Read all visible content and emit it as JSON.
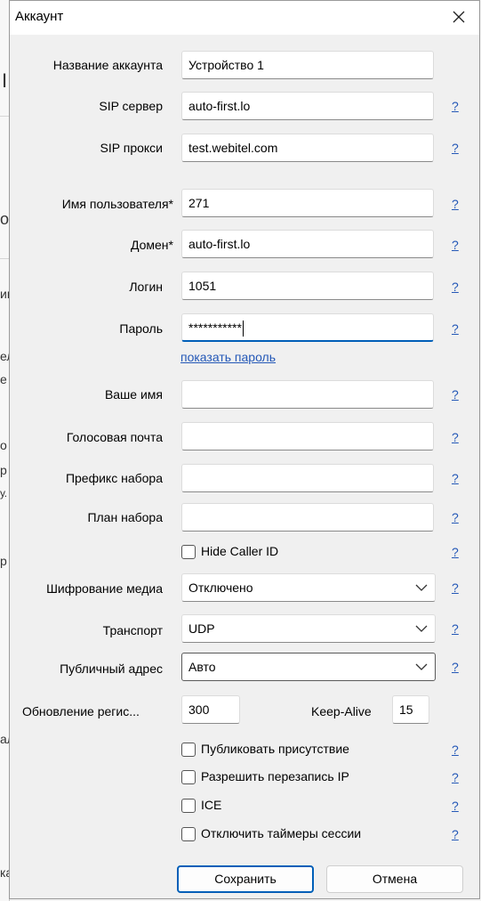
{
  "dialog": {
    "title": "Аккаунт",
    "help": "?",
    "fields": {
      "account_name": {
        "label": "Название аккаунта",
        "value": "Устройство 1"
      },
      "sip_server": {
        "label": "SIP сервер",
        "value": "auto-first.lo"
      },
      "sip_proxy": {
        "label": "SIP прокси",
        "value": "test.webitel.com"
      },
      "username": {
        "label": "Имя пользователя",
        "value": "271"
      },
      "domain": {
        "label": "Домен",
        "value": "auto-first.lo"
      },
      "login": {
        "label": "Логин",
        "value": "1051"
      },
      "password": {
        "label": "Пароль",
        "value": "***********"
      },
      "display_name": {
        "label": "Ваше имя",
        "value": ""
      },
      "voicemail": {
        "label": "Голосовая почта",
        "value": ""
      },
      "dial_prefix": {
        "label": "Префикс набора",
        "value": ""
      },
      "dial_plan": {
        "label": "План набора",
        "value": ""
      }
    },
    "required_mark": "*",
    "show_password_link": "показать пароль",
    "hide_caller_id": {
      "label": "Hide Caller ID",
      "checked": false
    },
    "media_encryption": {
      "label": "Шифрование медиа",
      "value": "Отключено"
    },
    "transport": {
      "label": "Транспорт",
      "value": "UDP"
    },
    "public_address": {
      "label": "Публичный адрес",
      "value": "Авто"
    },
    "registration_refresh": {
      "label": "Обновление регис...",
      "value": "300"
    },
    "keep_alive": {
      "label": "Keep-Alive",
      "value": "15"
    },
    "checkboxes": {
      "publish_presence": {
        "label": "Публиковать присутствие",
        "checked": false
      },
      "allow_ip_rewrite": {
        "label": "Разрешить перезапись IP",
        "checked": false
      },
      "ice": {
        "label": "ICE",
        "checked": false
      },
      "disable_session_timers": {
        "label": "Отключить таймеры сессии",
        "checked": false
      }
    },
    "buttons": {
      "save": "Сохранить",
      "cancel": "Отмена"
    }
  },
  "background": {
    "fragments": [
      "I",
      "о",
      "ии",
      "ел",
      "е",
      "о",
      "р",
      "у.",
      "р",
      "",
      "ал",
      "ка"
    ]
  },
  "colors": {
    "accent": "#005fb8",
    "link": "#2458b7",
    "dialog_bg": "#f0f0f0"
  }
}
